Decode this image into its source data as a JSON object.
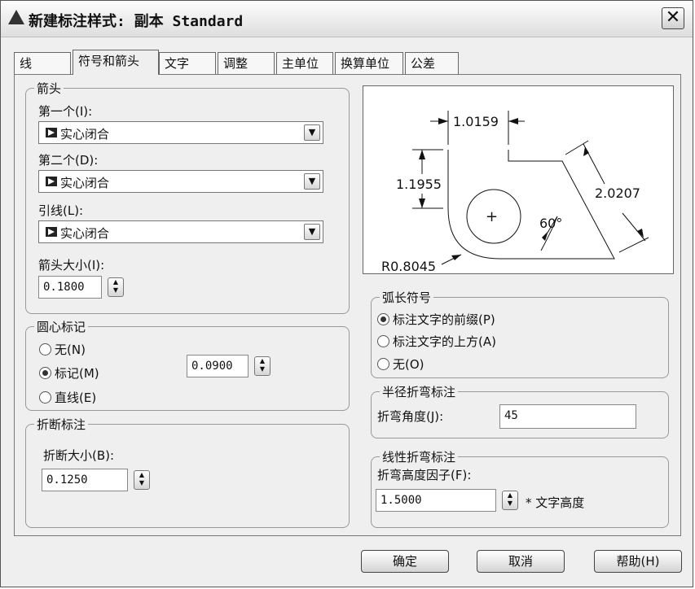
{
  "window": {
    "title": "新建标注样式: 副本 Standard",
    "close": "✕"
  },
  "tabs": [
    "线",
    "符号和箭头",
    "文字",
    "调整",
    "主单位",
    "换算单位",
    "公差"
  ],
  "arrows": {
    "title": "箭头",
    "first_label": "第一个(I):",
    "first_value": "实心闭合",
    "second_label": "第二个(D):",
    "second_value": "实心闭合",
    "leader_label": "引线(L):",
    "leader_value": "实心闭合",
    "size_label": "箭头大小(I):",
    "size_value": "0.1800"
  },
  "center_marks": {
    "title": "圆心标记",
    "none": "无(N)",
    "mark": "标记(M)",
    "line": "直线(E)",
    "selected": "mark",
    "size_value": "0.0900"
  },
  "break": {
    "title": "折断标注",
    "size_label": "折断大小(B):",
    "size_value": "0.1250"
  },
  "preview": {
    "dim_top": "1.0159",
    "dim_left": "1.1955",
    "dim_right": "2.0207",
    "angle": "60°",
    "radius": "R0.8045",
    "center": "+"
  },
  "arc_symbol": {
    "title": "弧长符号",
    "before": "标注文字的前缀(P)",
    "above": "标注文字的上方(A)",
    "none": "无(O)",
    "selected": "before"
  },
  "radius_jog": {
    "title": "半径折弯标注",
    "angle_label": "折弯角度(J):",
    "angle_value": "45"
  },
  "linear_jog": {
    "title": "线性折弯标注",
    "factor_label": "折弯高度因子(F):",
    "factor_value": "1.5000",
    "suffix": "* 文字高度"
  },
  "buttons": {
    "ok": "确定",
    "cancel": "取消",
    "help": "帮助(H)"
  }
}
